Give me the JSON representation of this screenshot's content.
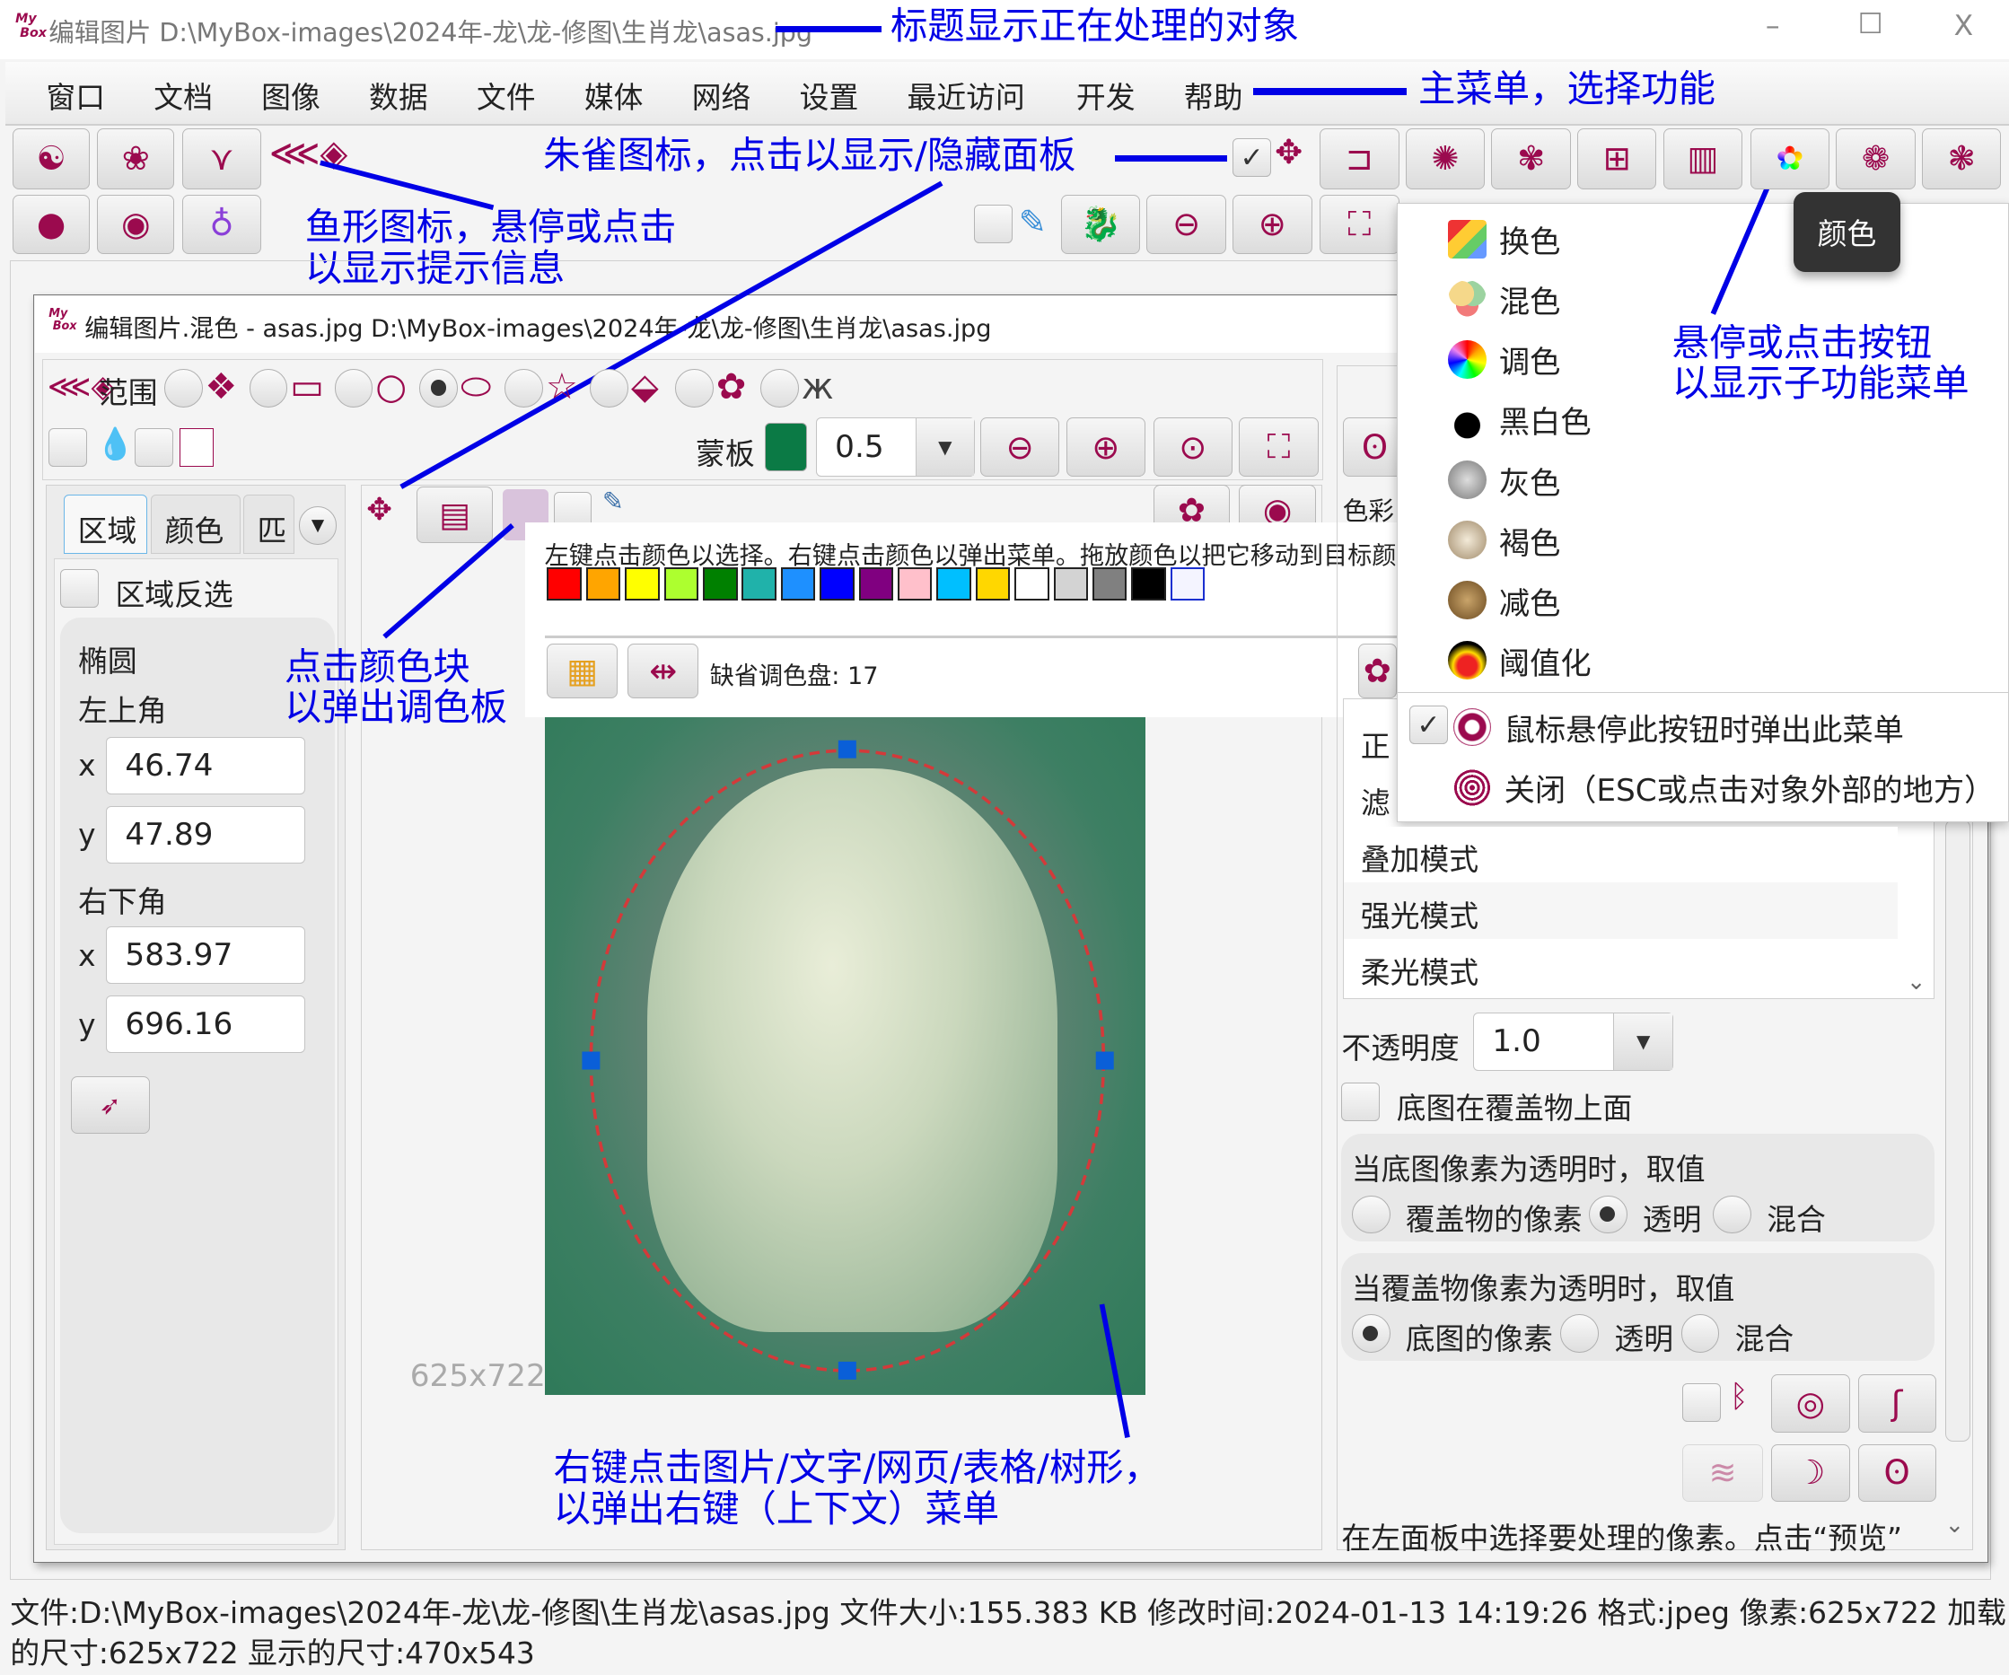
{
  "window": {
    "title": "编辑图片 D:\\MyBox-images\\2024年-龙\\龙-修图\\生肖龙\\asas.jpg",
    "logo": "MyBox",
    "minimize": "–",
    "maximize": "☐",
    "close": "X"
  },
  "menu": [
    "窗口",
    "文档",
    "图像",
    "数据",
    "文件",
    "媒体",
    "网络",
    "设置",
    "最近访问",
    "开发",
    "帮助"
  ],
  "annotations": {
    "title": "标题显示正在处理的对象",
    "menu": "主菜单，选择功能",
    "phoenix": "朱雀图标，点击以显示/隐藏面板",
    "fish_1": "鱼形图标，悬停或点击",
    "fish_2": "以显示提示信息",
    "color_block_1": "点击颜色块",
    "color_block_2": "以弹出调色板",
    "hover_1": "悬停或点击按钮",
    "hover_2": "以显示子功能菜单",
    "right_click_1": "右键点击图片/文字/网页/表格/树形，",
    "right_click_2": "以弹出右键（上下文）菜单"
  },
  "toolbar": {
    "panel_checked": true,
    "icons_row1": [
      "yin-yang-icon",
      "lotus-icon",
      "bird-icon",
      "fish-icon"
    ],
    "icons_right": [
      "scroll-icon",
      "chrysanthemum-icon",
      "flower-icon",
      "tile-icon",
      "frame-icon",
      "color-icon",
      "plum-icon",
      "peony-icon"
    ]
  },
  "tooltip": "颜色",
  "color_menu": {
    "items": [
      {
        "label": "换色",
        "icon": "palette-swatch-icon"
      },
      {
        "label": "混色",
        "icon": "blend-circles-icon"
      },
      {
        "label": "调色",
        "icon": "color-wheel-icon"
      },
      {
        "label": "黑白色",
        "icon": "paw-black-white-icon"
      },
      {
        "label": "灰色",
        "icon": "paw-gray-icon"
      },
      {
        "label": "褐色",
        "icon": "paw-sepia-icon"
      },
      {
        "label": "减色",
        "icon": "paw-reduce-icon"
      },
      {
        "label": "阈值化",
        "icon": "paw-threshold-icon"
      }
    ],
    "hover_popup": "鼠标悬停此按钮时弹出此菜单",
    "hover_popup_checked": true,
    "close": "关闭（ESC或点击对象外部的地方）"
  },
  "sub_window": {
    "title": "编辑图片.混色 - asas.jpg D:\\MyBox-images\\2024年-龙\\龙-修图\\生肖龙\\asas.jpg",
    "scope_label": "范围",
    "mask_label": "蒙板",
    "mask_color": "#0b7a45",
    "mask_opacity": "0.5"
  },
  "left_panel": {
    "tabs": [
      "区域",
      "颜色",
      "匹"
    ],
    "invert_label": "区域反选",
    "shape": "椭圆",
    "top_left": "左上角",
    "bottom_right": "右下角",
    "x1": "46.74",
    "y1": "47.89",
    "x2": "583.97",
    "y2": "696.16",
    "x_label": "x",
    "y_label": "y"
  },
  "palette": {
    "hint": "左键点击颜色以选择。右键点击颜色以弹出菜单。拖放颜色以把它移动到目标颜",
    "colors": [
      "#ff0000",
      "#ffa500",
      "#ffff00",
      "#adff2f",
      "#008000",
      "#20b2aa",
      "#1e90ff",
      "#0000ff",
      "#800080",
      "#ffc0cb",
      "#00bfff",
      "#ffd700",
      "#ffffff",
      "#d3d3d3",
      "#808080",
      "#000000",
      "#f4f4ff"
    ],
    "default_label": "缺省调色盘: 17"
  },
  "image": {
    "size_label": "625x722",
    "selection_color": "#d33a3a",
    "handle_color": "#0a5fd8"
  },
  "right_panel": {
    "partial_1": "正",
    "partial_2": "滤",
    "partial_3": "色彩",
    "modes": [
      "叠加模式",
      "强光模式",
      "柔光模式"
    ],
    "opacity_label": "不透明度",
    "opacity": "1.0",
    "base_on_top": "底图在覆盖物上面",
    "group1_title": "当底图像素为透明时，取值",
    "group1_options": [
      "覆盖物的像素",
      "透明",
      "混合"
    ],
    "group1_selected": 1,
    "group2_title": "当覆盖物像素为透明时，取值",
    "group2_options": [
      "底图的像素",
      "透明",
      "混合"
    ],
    "group2_selected": 0,
    "hint": "在左面板中选择要处理的像素。点击“预览”"
  },
  "status": {
    "line1": "文件:D:\\MyBox-images\\2024年-龙\\龙-修图\\生肖龙\\asas.jpg 文件大小:155.383 KB 修改时间:2024-01-13 14:19:26 格式:jpeg 像素:625x722 加载",
    "line2": "的尺寸:625x722 显示的尺寸:470x543"
  }
}
